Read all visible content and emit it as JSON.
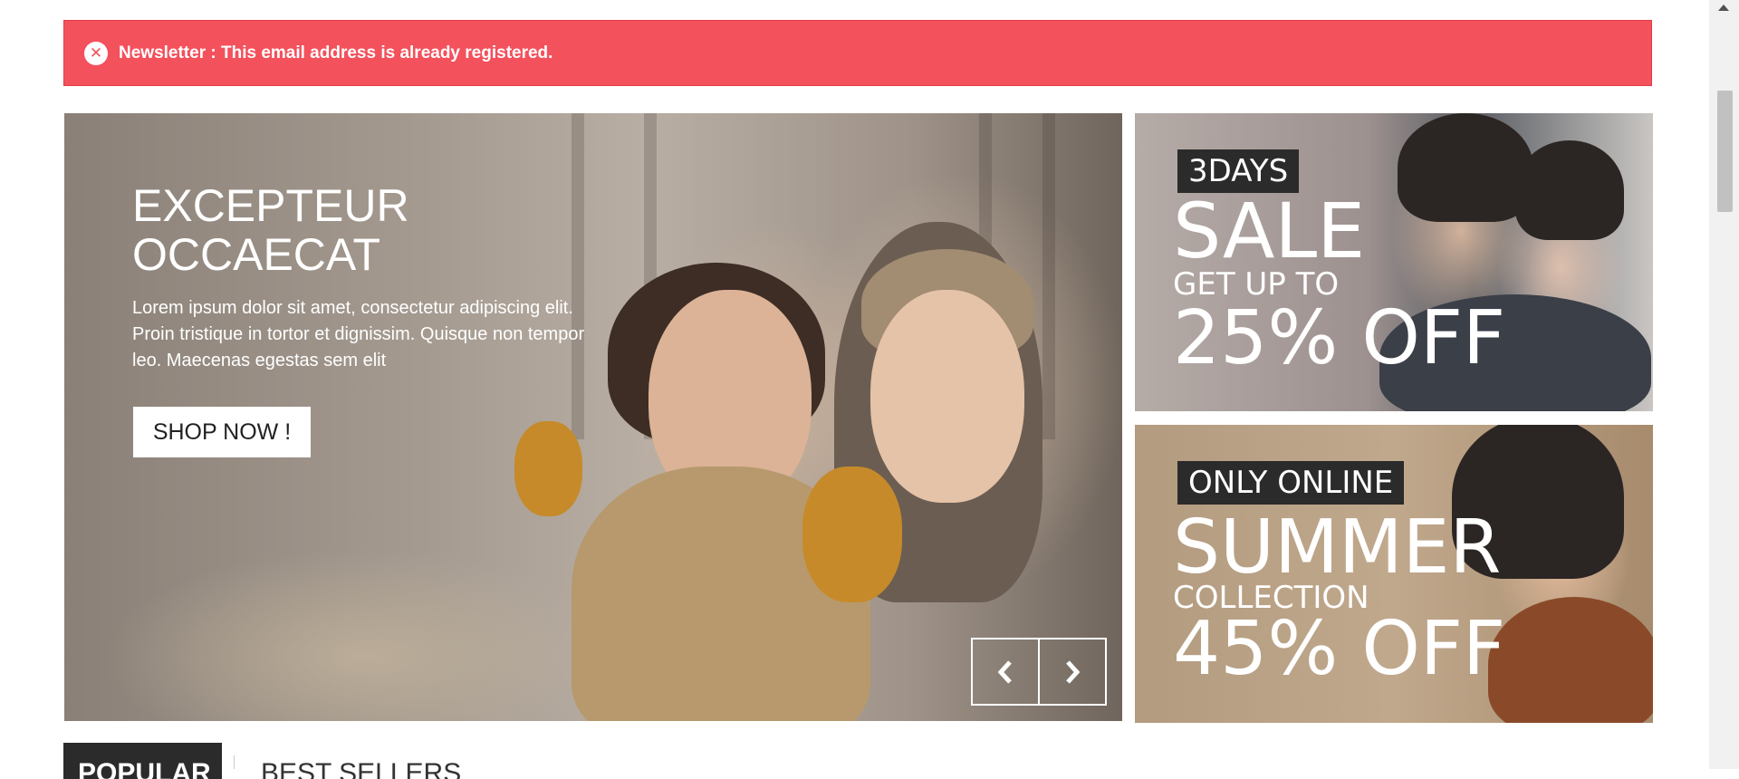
{
  "alert": {
    "icon": "close-circle-icon",
    "message": "Newsletter : This email address is already registered.",
    "color": "#f3515c"
  },
  "slider": {
    "headline_line1": "EXCEPTEUR",
    "headline_line2": "OCCAECAT",
    "description": "Lorem ipsum dolor sit amet, consectetur adipiscing elit. Proin tristique in tortor et dignissim. Quisque non tempor leo. Maecenas egestas sem elit",
    "cta_label": "SHOP NOW !",
    "prev_icon": "chevron-left-icon",
    "next_icon": "chevron-right-icon"
  },
  "banners": [
    {
      "tag": "3DAYS",
      "line1": "SALE",
      "line2": "GET UP TO",
      "line3": "25% OFF"
    },
    {
      "tag": "ONLY ONLINE",
      "line1": "SUMMER",
      "line2": "COLLECTION",
      "line3": "45% OFF"
    }
  ],
  "tabs": [
    {
      "label": "POPULAR",
      "active": true
    },
    {
      "label": "BEST SELLERS",
      "active": false
    }
  ],
  "colors": {
    "accent": "#f3515c",
    "dark": "#2b2b2b"
  }
}
